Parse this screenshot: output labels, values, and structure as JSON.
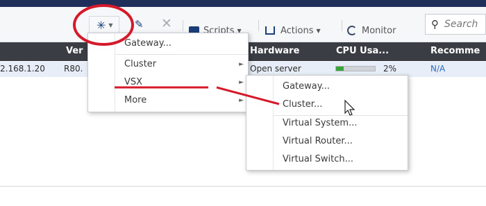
{
  "toolbar": {
    "new_button_icon": "asterisk-icon",
    "delete_icon": "close-icon",
    "scripts_label": "Scripts",
    "actions_label": "Actions",
    "monitor_label": "Monitor",
    "search_placeholder": "Search"
  },
  "table": {
    "headers": [
      "Ver",
      "Hardware",
      "CPU Usa...",
      "Recomme"
    ],
    "row": {
      "ip": "2.168.1.20",
      "version": "R80.",
      "hardware": "Open server",
      "cpu_percent_label": "2%",
      "cpu_fraction": 0.2,
      "recommended": "N/A"
    }
  },
  "new_menu": {
    "items": [
      {
        "label": "Gateway...",
        "has_submenu": false
      },
      {
        "label": "Cluster",
        "has_submenu": true
      },
      {
        "label": "VSX",
        "has_submenu": true
      },
      {
        "label": "More",
        "has_submenu": true
      }
    ]
  },
  "vsx_submenu": {
    "items": [
      {
        "label": "Gateway..."
      },
      {
        "label": "Cluster..."
      },
      {
        "label": "Virtual System..."
      },
      {
        "label": "Virtual Router..."
      },
      {
        "label": "Virtual Switch..."
      }
    ]
  },
  "colors": {
    "annotation": "#d6192a",
    "header_bg": "#3a3e44",
    "row_highlight": "#e7eef7",
    "cpu_fill": "#3aa53a"
  }
}
